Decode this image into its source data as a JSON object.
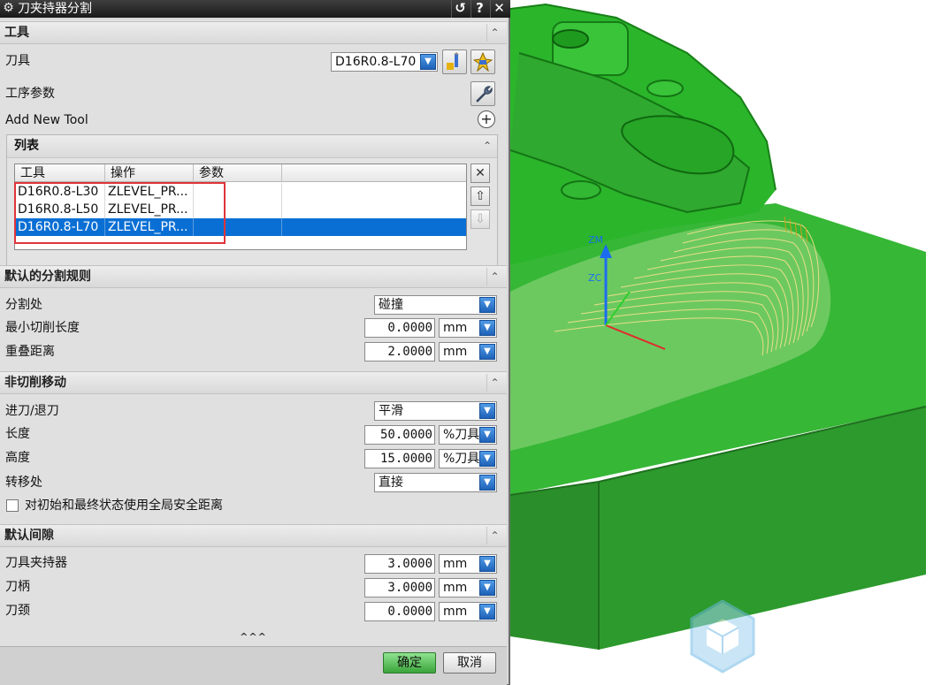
{
  "dialog": {
    "title": "刀夹持器分割",
    "title_buttons": [
      "↺",
      "?",
      "✕"
    ]
  },
  "tool_section": {
    "title": "工具",
    "tool_label": "刀具",
    "tool_value": "D16R0.8-L70",
    "op_params_label": "工序参数",
    "add_new_tool_label": "Add New Tool"
  },
  "list_section": {
    "title": "列表",
    "columns": [
      "工具",
      "操作",
      "参数"
    ],
    "rows": [
      {
        "tool": "D16R0.8-L30",
        "op": "ZLEVEL_PR...",
        "param": ""
      },
      {
        "tool": "D16R0.8-L50",
        "op": "ZLEVEL_PR...",
        "param": ""
      },
      {
        "tool": "D16R0.8-L70",
        "op": "ZLEVEL_PR...",
        "param": ""
      }
    ],
    "selected_row": 2
  },
  "split_rules": {
    "title": "默认的分割规则",
    "split_at_label": "分割处",
    "split_at_value": "碰撞",
    "min_cut_len_label": "最小切削长度",
    "min_cut_len_value": "0.0000",
    "min_cut_len_unit": "mm",
    "overlap_label": "重叠距离",
    "overlap_value": "2.0000",
    "overlap_unit": "mm"
  },
  "non_cutting": {
    "title": "非切削移动",
    "engage_label": "进刀/退刀",
    "engage_value": "平滑",
    "length_label": "长度",
    "length_value": "50.0000",
    "length_unit": "%刀具",
    "height_label": "高度",
    "height_value": "15.0000",
    "height_unit": "%刀具",
    "transfer_label": "转移处",
    "transfer_value": "直接",
    "global_safe_label": "对初始和最终状态使用全局安全距离",
    "global_safe_checked": false
  },
  "clearance": {
    "title": "默认间隙",
    "holder_label": "刀具夹持器",
    "holder_value": "3.0000",
    "holder_unit": "mm",
    "shank_label": "刀柄",
    "shank_value": "3.0000",
    "shank_unit": "mm",
    "neck_label": "刀颈",
    "neck_value": "0.0000",
    "neck_unit": "mm"
  },
  "more_indicator": "^^^",
  "footer": {
    "ok": "确定",
    "cancel": "取消"
  },
  "viewport": {
    "axis_labels": [
      "ZM",
      "ZC"
    ],
    "model_color": "#2fb82f",
    "toolpath_color": "#e8d27a"
  },
  "colors": {
    "selection": "#0a6fd4",
    "highlight_box": "#e0343a",
    "ok_button": "#4cbc4c"
  }
}
